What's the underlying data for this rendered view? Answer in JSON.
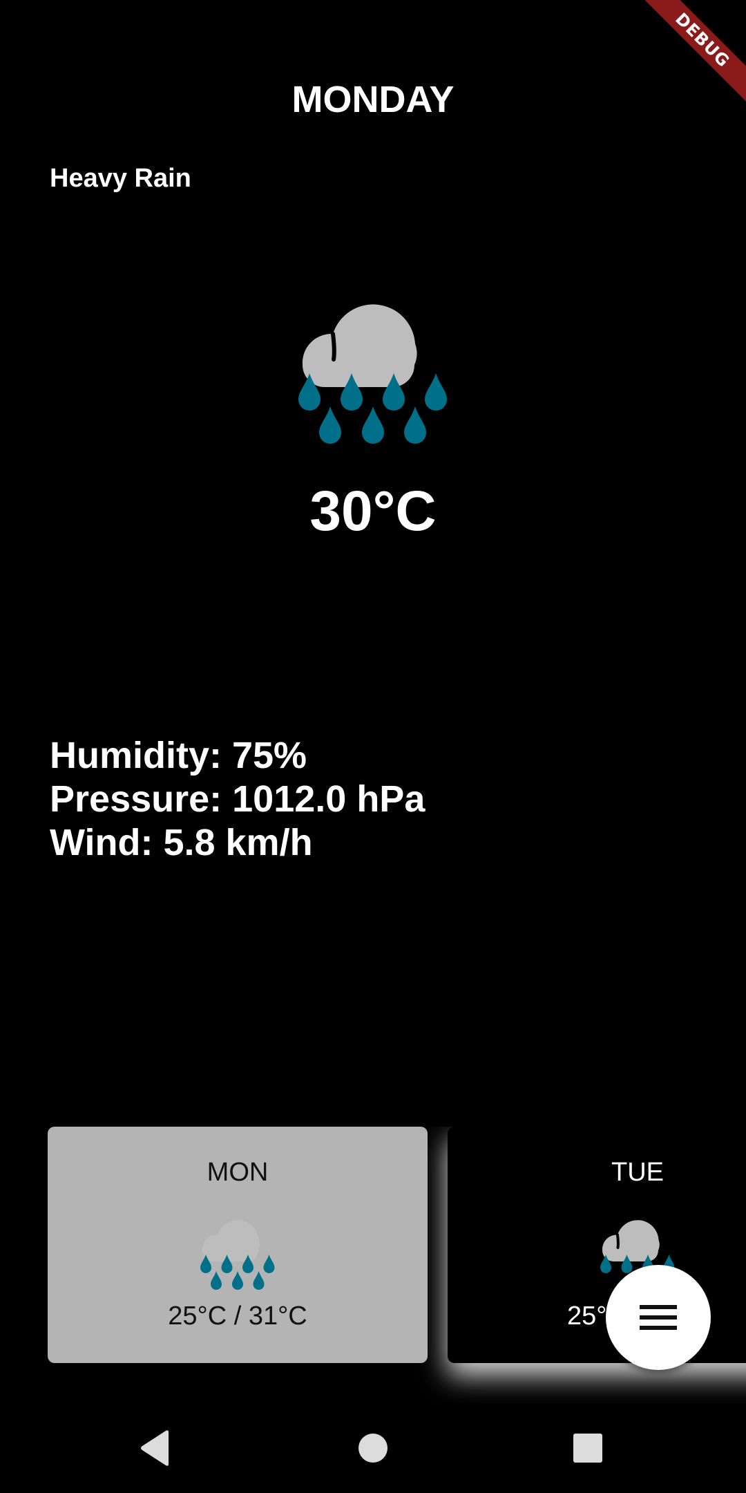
{
  "debug_banner": {
    "label": "DEBUG",
    "color": "#8b1a1a"
  },
  "header": {
    "day": "MONDAY"
  },
  "current": {
    "condition": "Heavy Rain",
    "icon": "heavy-rain-icon",
    "temperature": "30°C",
    "humidity": "Humidity: 75%",
    "pressure": "Pressure: 1012.0 hPa",
    "wind": "Wind: 5.8 km/h"
  },
  "forecast": [
    {
      "day": "MON",
      "icon": "heavy-rain-icon",
      "range": "25°C / 31°C",
      "selected": true
    },
    {
      "day": "TUE",
      "icon": "heavy-rain-icon",
      "range": "25°",
      "selected": false
    }
  ],
  "fab": {
    "icon": "menu-icon"
  },
  "nav": {
    "back": "back-icon",
    "home": "home-icon",
    "recents": "recents-icon"
  },
  "colors": {
    "background": "#000000",
    "cloud": "#bdbdbd",
    "raindrop": "#00708a",
    "selected_card": "#b4b4b4"
  }
}
